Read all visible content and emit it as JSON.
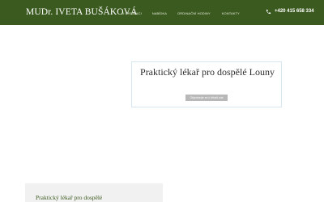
{
  "header": {
    "brand": "MUDr. IVETA BUŠÁKOVÁ",
    "nav": [
      {
        "label": "O ordinaci"
      },
      {
        "label": "Nabídka"
      },
      {
        "label": "Ordinační hodiny"
      },
      {
        "label": "Kontakty"
      }
    ],
    "phone": {
      "number": "+420 415 658 334",
      "icon": "phone-icon"
    }
  },
  "hero": {
    "title": "Praktický lékař pro dospělé Louny",
    "button_label": "Objednejte se k lékaři zde"
  },
  "content": {
    "heading": "Praktický lékař pro dospělé"
  },
  "colors": {
    "header_bg": "#3b5a1f",
    "accent_text": "#3b5a1f",
    "button_bg": "#b8b8b8"
  }
}
